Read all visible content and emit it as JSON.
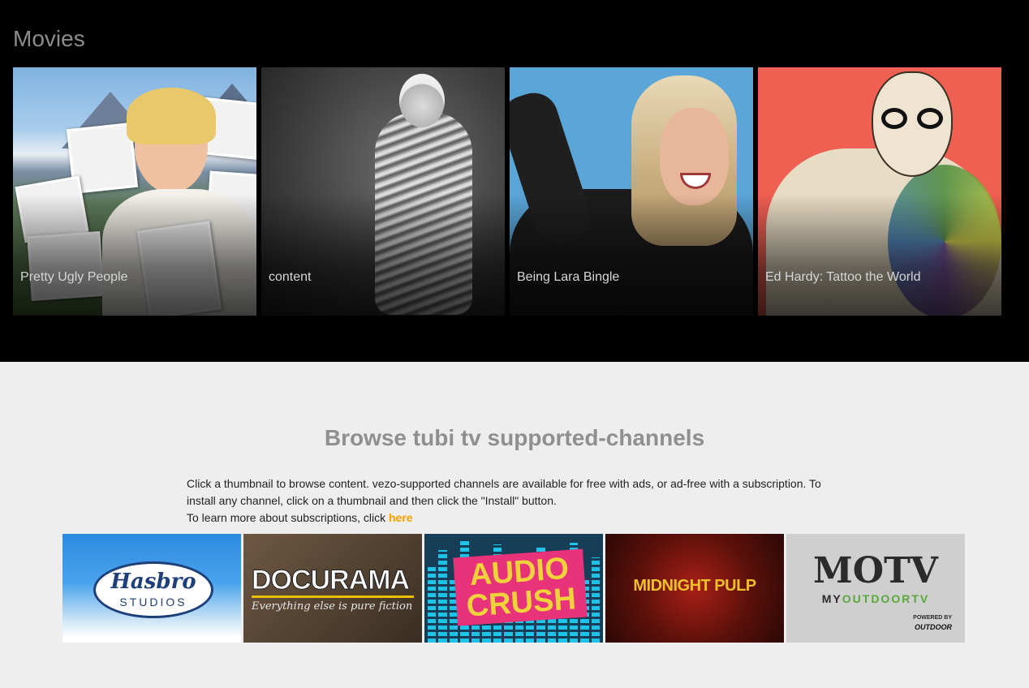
{
  "movies": {
    "heading": "Movies",
    "items": [
      {
        "title": "Pretty Ugly People"
      },
      {
        "title": "content"
      },
      {
        "title": "Being Lara Bingle"
      },
      {
        "title": "Ed Hardy: Tattoo the World"
      }
    ]
  },
  "channels": {
    "title": "Browse tubi tv supported-channels",
    "description_line1": "Click a thumbnail to browse content. vezo-supported channels are available for free with ads, or ad-free with a subscription. To install any channel, click on a thumbnail and then click the \"Install\" button.",
    "description_line2": "To learn more about subscriptions, click ",
    "link_text": "here",
    "tiles": [
      {
        "logo": "Hasbro",
        "sub": "STUDIOS"
      },
      {
        "logo": "DOCURAMA",
        "tagline": "Everything else is pure fiction"
      },
      {
        "logo": "AUDIO CRUSH"
      },
      {
        "logo": "MIDNIGHT PULP"
      },
      {
        "logo": "MOTV",
        "sub_a": "MY",
        "sub_b": "OUTDOOR",
        "sub_c": "TV",
        "powered": "POWERED BY",
        "brand": "OUTDOOR"
      }
    ]
  },
  "colors": {
    "band": "#000000",
    "page": "#eeeeee",
    "link": "#f5a000"
  }
}
